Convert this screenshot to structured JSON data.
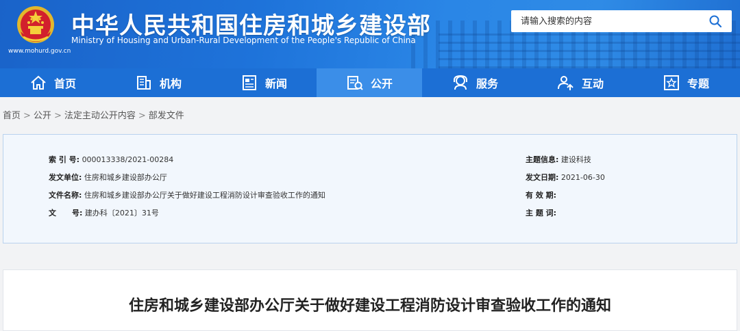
{
  "header": {
    "site_url": "www.mohurd.gov.cn",
    "title_cn": "中华人民共和国住房和城乡建设部",
    "title_en": "Ministry of Housing and Urban-Rural Development of the People's Republic of China",
    "search": {
      "placeholder": "请输入搜索的内容"
    }
  },
  "nav": {
    "items": [
      {
        "label": "首页",
        "icon": "home-icon"
      },
      {
        "label": "机构",
        "icon": "building-icon"
      },
      {
        "label": "新闻",
        "icon": "news-icon"
      },
      {
        "label": "公开",
        "icon": "open-docs-icon",
        "active": true
      },
      {
        "label": "服务",
        "icon": "service-icon"
      },
      {
        "label": "互动",
        "icon": "interact-icon"
      },
      {
        "label": "专题",
        "icon": "topic-icon"
      }
    ]
  },
  "breadcrumb": [
    "首页",
    "公开",
    "法定主动公开内容",
    "部发文件"
  ],
  "info": {
    "index_label": "索 引 号:",
    "index_value": "000013338/2021-00284",
    "issuer_label": "发文单位:",
    "issuer_value": "住房和城乡建设部办公厅",
    "name_label": "文件名称:",
    "name_value": "住房和城乡建设部办公厅关于做好建设工程消防设计审查验收工作的通知",
    "docno_label": "文      号:",
    "docno_value": "建办科〔2021〕31号",
    "topic_label": "主题信息:",
    "topic_value": "建设科技",
    "date_label": "发文日期:",
    "date_value": "2021-06-30",
    "validity_label": "有 效 期:",
    "validity_value": "",
    "keywords_label": "主 题 词:",
    "keywords_value": ""
  },
  "article": {
    "title": "住房和城乡建设部办公厅关于做好建设工程消防设计审查验收工作的通知"
  },
  "colors": {
    "header_blue": "#1e73da",
    "nav_blue": "#1c6fd5",
    "nav_active": "#3b8ee8",
    "info_bg": "#f2f7fd"
  }
}
